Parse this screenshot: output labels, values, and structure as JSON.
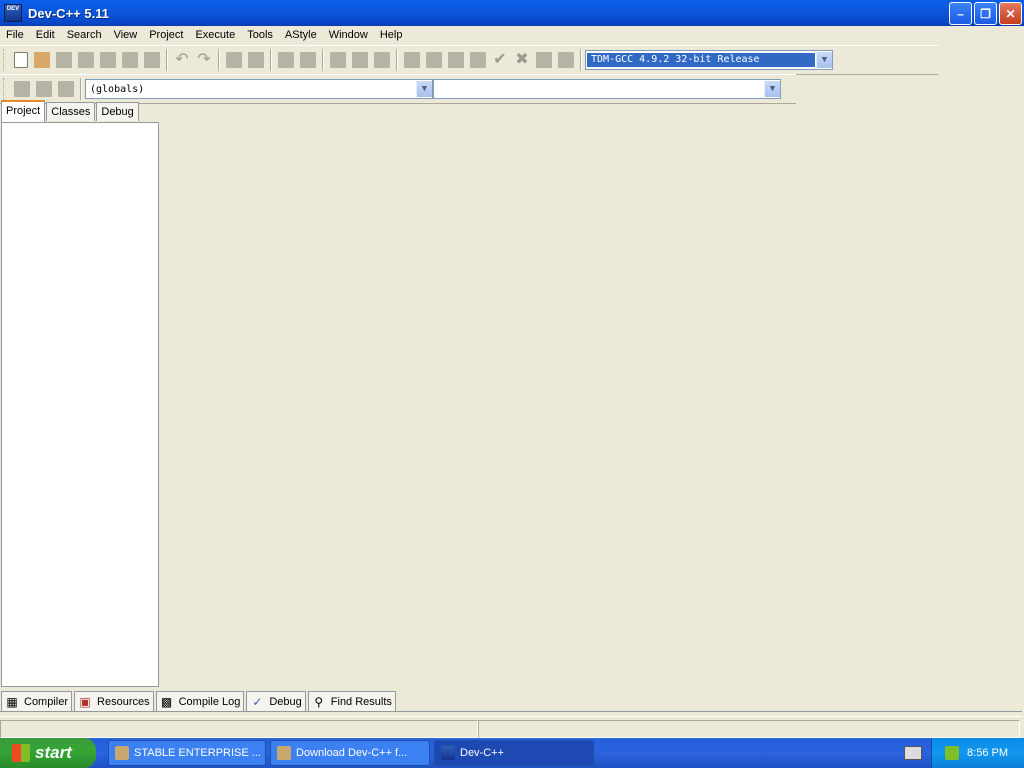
{
  "window": {
    "title": "Dev-C++ 5.11",
    "icon_label": "DEV",
    "controls": [
      "minimize-icon",
      "restore-icon",
      "close-icon"
    ]
  },
  "menu": {
    "items": [
      {
        "label": "File"
      },
      {
        "label": "Edit"
      },
      {
        "label": "Search"
      },
      {
        "label": "View"
      },
      {
        "label": "Project"
      },
      {
        "label": "Execute"
      },
      {
        "label": "Tools"
      },
      {
        "label": "AStyle"
      },
      {
        "label": "Window"
      },
      {
        "label": "Help"
      }
    ]
  },
  "toolbar": {
    "compiler_select": "TDM-GCC 4.9.2 32-bit Release",
    "scope_select": "(globals)",
    "member_select": ""
  },
  "left_tabs": [
    {
      "label": "Project",
      "active": true
    },
    {
      "label": "Classes",
      "active": false
    },
    {
      "label": "Debug",
      "active": false
    }
  ],
  "bottom_tabs": [
    {
      "label": "Compiler",
      "icon": "grid-icon"
    },
    {
      "label": "Resources",
      "icon": "resources-icon"
    },
    {
      "label": "Compile Log",
      "icon": "bar-chart-icon"
    },
    {
      "label": "Debug",
      "icon": "check-icon"
    },
    {
      "label": "Find Results",
      "icon": "search-icon"
    }
  ],
  "taskbar": {
    "start_label": "start",
    "tasks": [
      {
        "label": "STABLE ENTERPRISE ...",
        "active": false
      },
      {
        "label": "Download Dev-C++ f...",
        "active": false
      },
      {
        "label": "Dev-C++",
        "active": true
      }
    ],
    "clock": "8:56 PM"
  }
}
